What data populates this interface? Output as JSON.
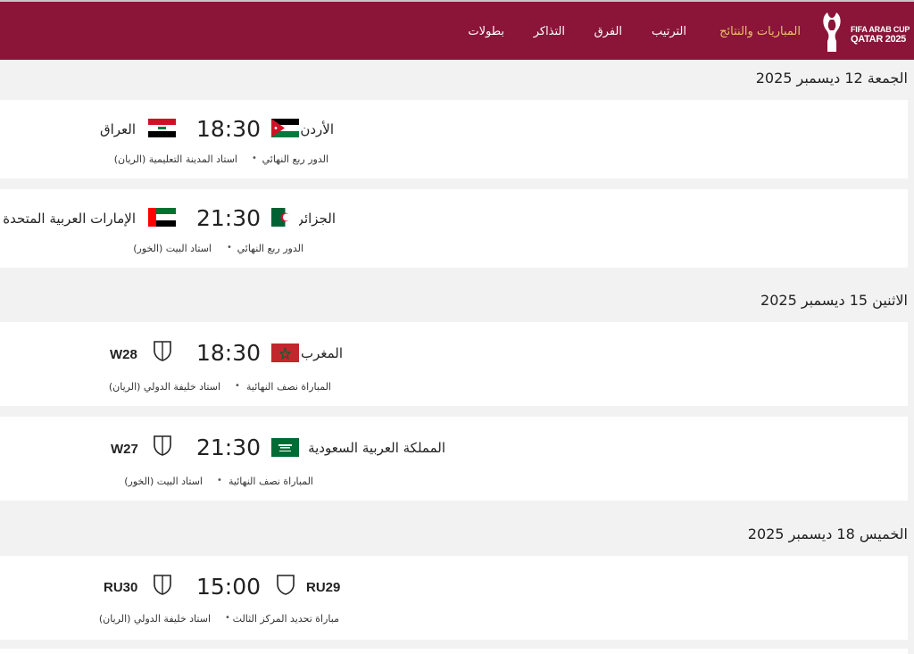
{
  "header": {
    "logo_line1": "FIFA ARAB CUP",
    "logo_line2": "QATAR 2025",
    "nav": [
      {
        "label": "المباريات والنتائج",
        "active": true
      },
      {
        "label": "الترتيب"
      },
      {
        "label": "الفرق"
      },
      {
        "label": "التذاكر"
      },
      {
        "label": "بطولات"
      }
    ]
  },
  "days": [
    {
      "date": "الجمعة 12 ديسمبر 2025",
      "matches": [
        {
          "home": "الأردن",
          "away": "العراق",
          "time": "18:30",
          "stage": "الدور ربع النهائي",
          "venue": "استاد المدينة التعليمية (الريان)",
          "home_flag": "jordan-flag",
          "away_flag": "iraq-flag"
        },
        {
          "home": "الجزائر",
          "away": "الإمارات العربية المتحدة",
          "time": "21:30",
          "stage": "الدور ربع النهائي",
          "venue": "استاد البيت (الخور)",
          "home_flag": "algeria-flag",
          "away_flag": "uae-flag"
        }
      ]
    },
    {
      "date": "الاثنين 15 ديسمبر 2025",
      "matches": [
        {
          "home": "المغرب",
          "away": "W28",
          "time": "18:30",
          "stage": "المباراة نصف النهائية",
          "venue": "استاد خليفة الدولي (الريان)",
          "home_flag": "morocco-flag",
          "away_flag": "placeholder-shield-icon"
        },
        {
          "home": "المملكة العربية السعودية",
          "away": "W27",
          "time": "21:30",
          "stage": "المباراة نصف النهائية",
          "venue": "استاد البيت (الخور)",
          "home_flag": "saudi-arabia-flag",
          "away_flag": "placeholder-shield-icon"
        }
      ]
    },
    {
      "date": "الخميس 18 ديسمبر 2025",
      "matches": [
        {
          "home": "RU29",
          "away": "RU30",
          "time": "15:00",
          "stage": "مباراة تحديد المركز الثالث",
          "venue": "استاد خليفة الدولي (الريان)",
          "home_flag": "placeholder-shield-icon",
          "away_flag": "placeholder-shield-icon"
        }
      ]
    }
  ],
  "colors": {
    "header": "#8a1538",
    "nav_active": "#e8c26a",
    "background": "#f2f2f2",
    "card": "#ffffff"
  }
}
